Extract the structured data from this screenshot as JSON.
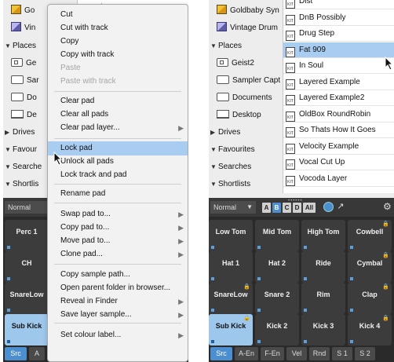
{
  "left_tree": {
    "items": [
      {
        "label": "Go"
      },
      {
        "label": "Vin"
      },
      {
        "label": "Places",
        "toggle": "▼"
      },
      {
        "label": "Ge"
      },
      {
        "label": "Sar"
      },
      {
        "label": "Do"
      },
      {
        "label": "De"
      },
      {
        "label": "Drives",
        "toggle": "▶"
      },
      {
        "label": "Favour",
        "toggle": "▼"
      },
      {
        "label": "Searche",
        "toggle": "▼"
      },
      {
        "label": "Shortlis",
        "toggle": "▼"
      }
    ]
  },
  "left_list_fragments": {
    "top": "Dist",
    "right": "k"
  },
  "context_menu": {
    "items": [
      {
        "label": "Cut"
      },
      {
        "label": "Cut with track"
      },
      {
        "label": "Copy"
      },
      {
        "label": "Copy with track"
      },
      {
        "label": "Paste",
        "disabled": true
      },
      {
        "label": "Paste with track",
        "disabled": true
      },
      {
        "label": "Clear pad"
      },
      {
        "label": "Clear all pads"
      },
      {
        "label": "Clear pad layer...",
        "submenu": true
      },
      {
        "label": "Lock pad",
        "highlighted": true
      },
      {
        "label": "Unlock all pads"
      },
      {
        "label": "Lock track and pad"
      },
      {
        "label": "Rename pad"
      },
      {
        "label": "Swap pad to...",
        "submenu": true
      },
      {
        "label": "Copy pad to...",
        "submenu": true
      },
      {
        "label": "Move pad to...",
        "submenu": true
      },
      {
        "label": "Clone pad...",
        "submenu": true
      },
      {
        "label": "Copy sample path..."
      },
      {
        "label": "Open parent folder in browser..."
      },
      {
        "label": "Reveal in Finder",
        "submenu": true
      },
      {
        "label": "Save layer sample...",
        "submenu": true
      },
      {
        "label": "Set colour label...",
        "submenu": true
      }
    ]
  },
  "left_controls": {
    "mode": "Normal"
  },
  "left_pads": [
    {
      "label": "Perc 1"
    },
    {
      "label": "CH"
    },
    {
      "label": "SnareLow"
    },
    {
      "label": "Sub Kick",
      "selected": true
    }
  ],
  "left_tabs": [
    {
      "label": "Src",
      "active": true
    },
    {
      "label": "A"
    }
  ],
  "right_tree": {
    "items": [
      {
        "label": "Goldbaby Syn"
      },
      {
        "label": "Vintage Drum"
      },
      {
        "label": "Places",
        "toggle": "▼"
      },
      {
        "label": "Geist2"
      },
      {
        "label": "Sampler Capt"
      },
      {
        "label": "Documents"
      },
      {
        "label": "Desktop"
      },
      {
        "label": "Drives",
        "toggle": "▶"
      },
      {
        "label": "Favourites",
        "toggle": "▼"
      },
      {
        "label": "Searches",
        "toggle": "▼"
      },
      {
        "label": "Shortlists",
        "toggle": "▼"
      }
    ]
  },
  "right_list": {
    "items": [
      {
        "label": "Dist"
      },
      {
        "label": "DnB Possibly"
      },
      {
        "label": "Drug Step"
      },
      {
        "label": "Fat 909",
        "selected": true
      },
      {
        "label": "In Soul"
      },
      {
        "label": "Layered Example"
      },
      {
        "label": "Layered Example2"
      },
      {
        "label": "OldBox RoundRobin"
      },
      {
        "label": "So Thats How It Goes"
      },
      {
        "label": "Velocity Example"
      },
      {
        "label": "Vocal Cut Up"
      },
      {
        "label": "Vocoda Layer"
      }
    ],
    "file_icon_text": "KIT"
  },
  "right_controls": {
    "mode": "Normal",
    "mode_arrow": "▼",
    "banks": [
      "A",
      "B",
      "C",
      "D",
      "All"
    ],
    "active_bank": "B",
    "dots": "••••••"
  },
  "right_pads": [
    {
      "label": "Low Tom"
    },
    {
      "label": "Mid Tom"
    },
    {
      "label": "High Tom"
    },
    {
      "label": "Cowbell",
      "locked": true
    },
    {
      "label": "Hat 1"
    },
    {
      "label": "Hat 2"
    },
    {
      "label": "Ride"
    },
    {
      "label": "Cymbal",
      "locked": true
    },
    {
      "label": "SnareLow",
      "locked": true
    },
    {
      "label": "Snare 2"
    },
    {
      "label": "Rim"
    },
    {
      "label": "Clap",
      "locked": true
    },
    {
      "label": "Sub Kick",
      "locked": true,
      "selected": true
    },
    {
      "label": "Kick 2"
    },
    {
      "label": "Kick 3"
    },
    {
      "label": "Kick 4",
      "locked": true
    }
  ],
  "right_tabs": [
    {
      "label": "Src",
      "active": true
    },
    {
      "label": "A-En"
    },
    {
      "label": "F-En"
    },
    {
      "label": "Vel"
    },
    {
      "label": "Rnd"
    },
    {
      "label": "S 1"
    },
    {
      "label": "S 2"
    }
  ],
  "glyphs": {
    "submenu_arrow": "▶",
    "lock": "🔒",
    "gear": "⚙",
    "arrow_btn": "↗"
  },
  "colors": {
    "selection": "#a9cdf0",
    "accent": "#4c8fd0",
    "pad": "#3c3c3c",
    "pad_selected": "#9ec7ec"
  }
}
